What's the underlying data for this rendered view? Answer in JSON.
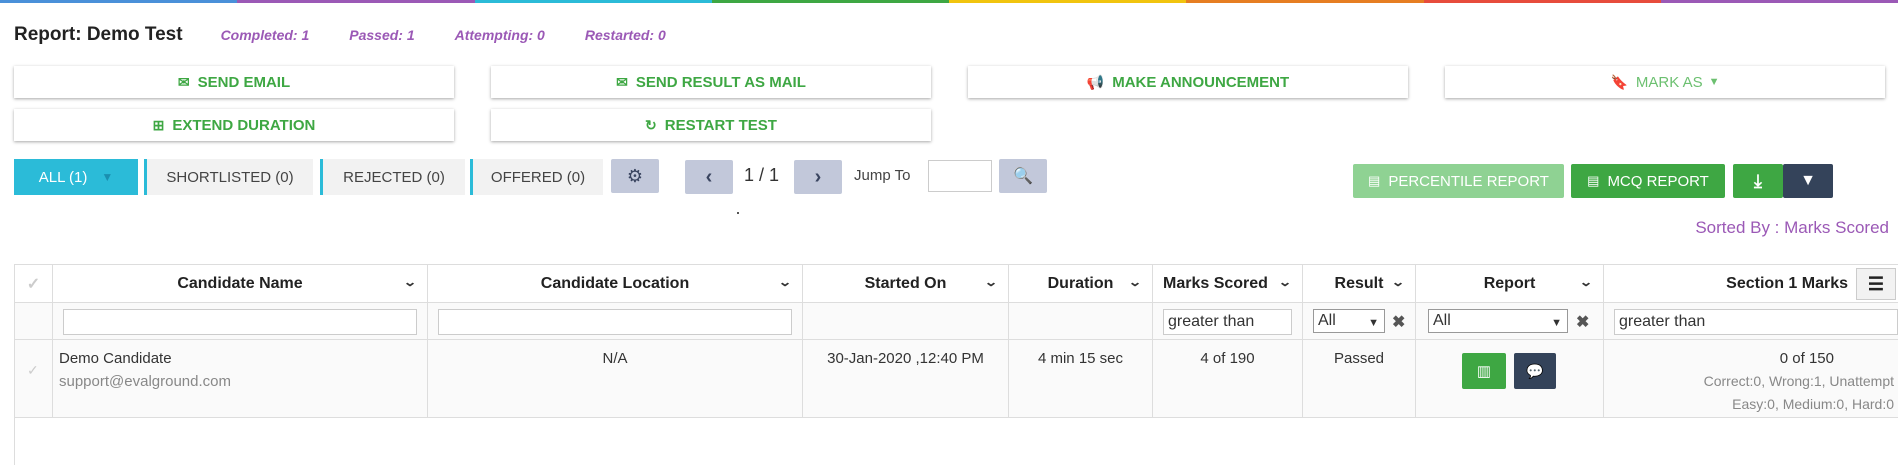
{
  "header": {
    "title": "Report: Demo Test",
    "stats": [
      "Completed: 1",
      "Passed: 1",
      "Attempting: 0",
      "Restarted: 0"
    ]
  },
  "actions": {
    "send_email": "SEND EMAIL",
    "send_result_mail": "SEND RESULT AS MAIL",
    "make_announcement": "MAKE ANNOUNCEMENT",
    "mark_as": "MARK AS",
    "extend_duration": "EXTEND DURATION",
    "restart_test": "RESTART TEST"
  },
  "tabs": [
    "ALL (1)",
    "SHORTLISTED (0)",
    "REJECTED (0)",
    "OFFERED (0)"
  ],
  "pager": {
    "page": "1 / 1",
    "jump_label": "Jump To",
    "jump_value": ""
  },
  "reports": {
    "percentile": "PERCENTILE REPORT",
    "mcq": "MCQ REPORT"
  },
  "sorted_by": "Sorted By : Marks Scored",
  "table": {
    "headers": [
      "Candidate Name",
      "Candidate Location",
      "Started On",
      "Duration",
      "Marks Scored",
      "Result",
      "Report",
      "Section 1 Marks"
    ],
    "filters": {
      "name": "",
      "location": "",
      "marks": "greater than",
      "result": "All",
      "report": "All",
      "section": "greater than"
    },
    "row": {
      "name": "Demo Candidate",
      "email": "support@evalground.com",
      "location": "N/A",
      "started": "30-Jan-2020 ,12:40 PM",
      "duration": "4 min 15 sec",
      "marks": "4 of 190",
      "result": "Passed",
      "section_marks": "0 of 150",
      "section_detail1": "Correct:0, Wrong:1, Unattempt",
      "section_detail2": "Easy:0, Medium:0, Hard:0"
    }
  },
  "colors": {
    "green": "#3ea743",
    "cyan": "#2bbbd8",
    "purple": "#9b59b6",
    "navy": "#34435a"
  }
}
